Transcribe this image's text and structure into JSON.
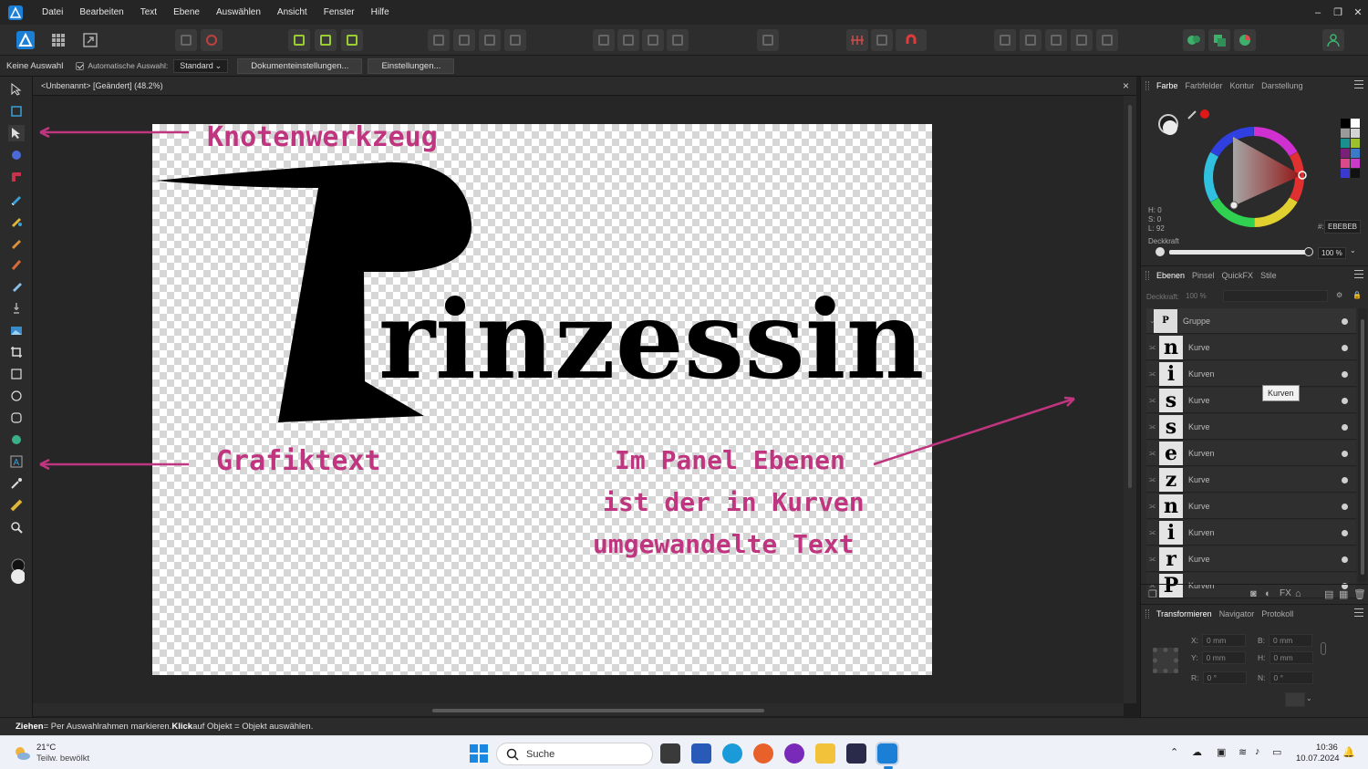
{
  "menu": {
    "items": [
      "Datei",
      "Bearbeiten",
      "Text",
      "Ebene",
      "Auswählen",
      "Ansicht",
      "Fenster",
      "Hilfe"
    ]
  },
  "window_controls": {
    "minimize": "–",
    "restore": "❐",
    "close": "✕"
  },
  "context": {
    "selection": "Keine Auswahl",
    "auto_select_label": "Automatische Auswahl:",
    "auto_select_value": "Standard",
    "doc_settings": "Dokumenteinstellungen...",
    "settings": "Einstellungen..."
  },
  "document": {
    "tab_title": "<Unbenannt> [Geändert] (48.2%)",
    "close": "×"
  },
  "canvas": {
    "word_big": "P",
    "word_rest": "rinzessin"
  },
  "annotations": {
    "node_tool": "Knotenwerkzeug",
    "artistic_text": "Grafiktext",
    "layers_note_1": "Im Panel Ebenen",
    "layers_note_2": "ist der in Kurven",
    "layers_note_3": "umgewandelte Text",
    "color": "#c0357f"
  },
  "status": {
    "drag_key": "Ziehen",
    "drag_text": " = Per Auswahlrahmen markieren. ",
    "click_key": "Klick",
    "click_text": " auf Objekt = Objekt auswählen."
  },
  "color_panel": {
    "tabs": [
      "Farbe",
      "Farbfelder",
      "Kontur",
      "Darstellung"
    ],
    "h": "H: 0",
    "s": "S: 0",
    "l": "L: 92",
    "hex_label": "#:",
    "hex": "EBEBEB",
    "opacity_label": "Deckkraft",
    "opacity": "100 %",
    "swatches": [
      "#000000",
      "#ffffff",
      "#9a9a9a",
      "#d4d4d4",
      "#1a8f8f",
      "#9bc22a",
      "#7a1f7a",
      "#3a7ac8",
      "#d84a8a",
      "#c83ac8",
      "#3a3ad0",
      "#111111"
    ]
  },
  "layers_panel": {
    "tabs": [
      "Ebenen",
      "Pinsel",
      "QuickFX",
      "Stile"
    ],
    "opacity_label": "Deckkraft:",
    "opacity": "100 %",
    "group": {
      "name": "Gruppe"
    },
    "items": [
      {
        "glyph": "n",
        "name": "Kurve"
      },
      {
        "glyph": "i",
        "name": "Kurven"
      },
      {
        "glyph": "s",
        "name": "Kurve"
      },
      {
        "glyph": "s",
        "name": "Kurve"
      },
      {
        "glyph": "e",
        "name": "Kurven"
      },
      {
        "glyph": "z",
        "name": "Kurve"
      },
      {
        "glyph": "n",
        "name": "Kurve"
      },
      {
        "glyph": "i",
        "name": "Kurven"
      },
      {
        "glyph": "r",
        "name": "Kurve"
      },
      {
        "glyph": "P",
        "name": "Kurven"
      }
    ],
    "tooltip": "Kurven"
  },
  "transform_panel": {
    "tabs": [
      "Transformieren",
      "Navigator",
      "Protokoll"
    ],
    "x_label": "X:",
    "x": "0 mm",
    "y_label": "Y:",
    "y": "0 mm",
    "w_label": "B:",
    "w": "0 mm",
    "h_label": "H:",
    "h": "0 mm",
    "r_label": "R:",
    "r": "0 °",
    "s_label": "N:",
    "s": "0 °"
  },
  "taskbar": {
    "temp": "21°C",
    "weather": "Teilw. bewölkt",
    "search": "Suche",
    "time": "10:36",
    "date": "10.07.2024"
  }
}
